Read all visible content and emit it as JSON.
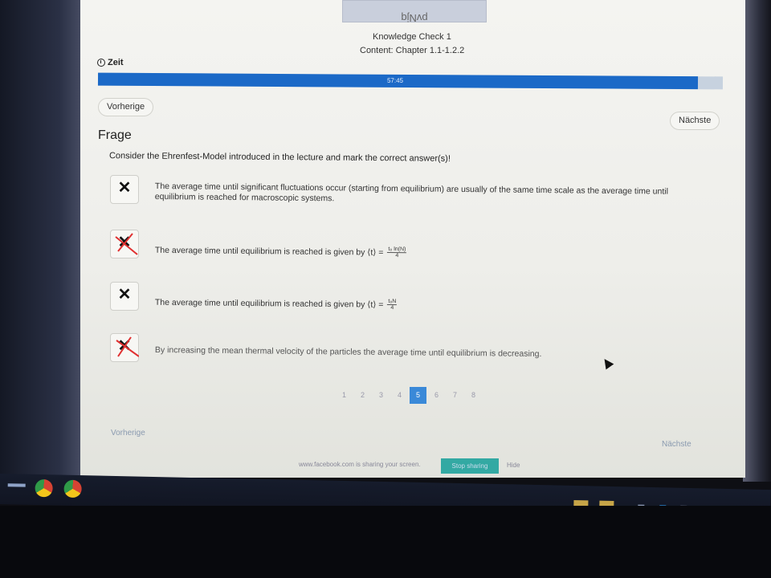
{
  "header": {
    "top_tab": "pvNjq",
    "title": "Knowledge Check 1",
    "content": "Content: Chapter 1.1-1.2.2"
  },
  "timer": {
    "label": "Zeit",
    "time": "57:45",
    "progress_fraction": 0.96
  },
  "nav": {
    "prev_label": "Vorherige",
    "next_label": "Nächste"
  },
  "question": {
    "heading": "Frage",
    "text": "Consider the Ehrenfest-Model introduced in the lecture and mark the correct answer(s)!"
  },
  "answers": [
    {
      "text": "The average time until significant fluctuations occur (starting from equilibrium) are usually of the same time scale as the average time until equilibrium is reached for macroscopic systems.",
      "checked": true,
      "red_mark": false
    },
    {
      "text": "The average time until equilibrium is reached is given by ⟨t⟩ =",
      "formula_num": "t₀ ln(N)",
      "formula_den": "4",
      "checked": true,
      "red_mark": true
    },
    {
      "text": "The average time until equilibrium is reached is given by ⟨t⟩ =",
      "formula_num": "t₀N",
      "formula_den": "4",
      "checked": true,
      "red_mark": false
    },
    {
      "text": "By increasing the mean thermal velocity of the particles the average time until equilibrium is decreasing.",
      "checked": true,
      "red_mark": true
    }
  ],
  "pager": {
    "pages": [
      "1",
      "2",
      "3",
      "4",
      "5",
      "6",
      "7",
      "8"
    ],
    "active": "5"
  },
  "footer": {
    "prev_label": "Vorherige",
    "next_label": "Nächste"
  },
  "share_bar": {
    "text": "www.facebook.com is sharing your screen.",
    "stop_label": "Stop sharing",
    "hide_label": "Hide"
  },
  "colors": {
    "progress": "#1b69c7",
    "active_page": "#3a89d8",
    "red_mark": "#e03030",
    "stop_share": "#33a9a3"
  }
}
